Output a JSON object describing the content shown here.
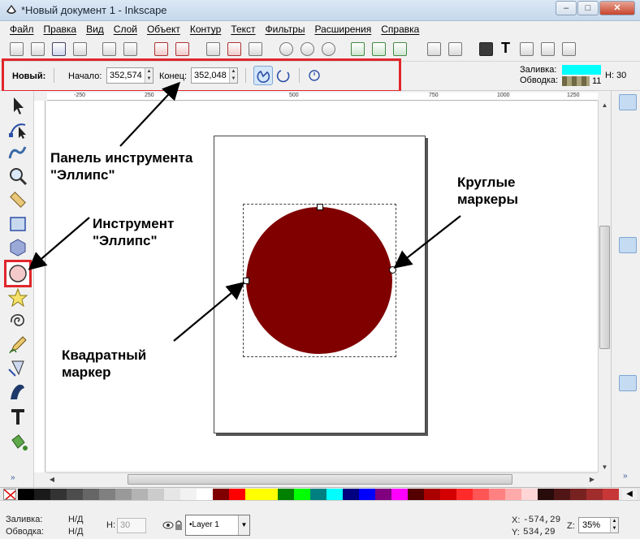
{
  "window": {
    "title": "*Новый документ 1 - Inkscape",
    "controls": {
      "minimize": "–",
      "maximize": "□",
      "close": "✕"
    }
  },
  "menubar": {
    "items": [
      "Файл",
      "Правка",
      "Вид",
      "Слой",
      "Объект",
      "Контур",
      "Текст",
      "Фильтры",
      "Расширения",
      "Справка"
    ]
  },
  "commands_toolbar": {
    "icons": [
      "new-doc-icon",
      "open-icon",
      "save-icon",
      "print-icon",
      "import-icon",
      "export-icon",
      "undo-icon",
      "redo-icon",
      "copy-icon",
      "cut-icon",
      "paste-icon",
      "zoom-selection-icon",
      "zoom-drawing-icon",
      "zoom-page-icon",
      "duplicate-icon",
      "clone-icon",
      "unlink-clone-icon",
      "group-icon",
      "ungroup-icon",
      "fill-stroke-icon",
      "text-font-icon",
      "layers-icon",
      "xml-editor-icon",
      "align-icon"
    ]
  },
  "tool_controls": {
    "new_label": "Новый:",
    "start_label": "Начало:",
    "start_value": "352,574",
    "end_label": "Конец:",
    "end_value": "352,048",
    "arc_buttons": [
      "arc-slice-icon",
      "arc-open-icon",
      "make-whole-icon"
    ]
  },
  "style_indicator": {
    "fill_label": "Заливка:",
    "stroke_label": "Обводка:",
    "stroke_width": "11",
    "h_label": "H: 30",
    "fill_color": "#00ffff"
  },
  "toolbox": {
    "tools": [
      "selector-icon",
      "node-editor-icon",
      "tweak-icon",
      "zoom-icon",
      "measure-icon",
      "rectangle-icon",
      "3d-box-icon",
      "ellipse-icon",
      "star-icon",
      "spiral-icon",
      "pencil-icon",
      "pen-icon",
      "calligraphy-icon",
      "text-tool-icon",
      "paint-bucket-icon"
    ],
    "selected_tool": "ellipse-icon",
    "more": "»"
  },
  "rulers": {
    "top_ticks": [
      "-250",
      "250",
      "500",
      "750",
      "1000",
      "1250"
    ]
  },
  "canvas": {
    "ellipse_color": "#800000"
  },
  "annotations": {
    "panel": "Панель инструмента\n\"Эллипс\"",
    "tool": "Инструмент\n\"Эллипс\"",
    "round": "Круглые\nмаркеры",
    "square": "Квадратный\nмаркер"
  },
  "palette": {
    "colors": [
      "#000000",
      "#1a1a1a",
      "#333333",
      "#4d4d4d",
      "#666666",
      "#808080",
      "#999999",
      "#b3b3b3",
      "#cccccc",
      "#e6e6e6",
      "#f2f2f2",
      "#ffffff",
      "#800000",
      "#ff0000",
      "#ffff00",
      "#ffff00",
      "#008000",
      "#00ff00",
      "#008080",
      "#00ffff",
      "#000080",
      "#0000ff",
      "#800080",
      "#ff00ff",
      "#550000",
      "#aa0000",
      "#d40000",
      "#ff2a2a",
      "#ff5555",
      "#ff8080",
      "#ffaaaa",
      "#ffd5d5",
      "#280b0b",
      "#501616",
      "#782121",
      "#a02c2c",
      "#c83737"
    ]
  },
  "statusbar": {
    "fill_label": "Заливка:",
    "fill_value": "Н/Д",
    "stroke_label": "Обводка:",
    "stroke_value": "Н/Д",
    "h_label": "H:",
    "h_value": "30",
    "layer": "•Layer 1",
    "x_label": "X:",
    "x_value": "-574,29",
    "y_label": "Y:",
    "y_value": "534,29",
    "z_label": "Z:",
    "zoom": "35%"
  }
}
